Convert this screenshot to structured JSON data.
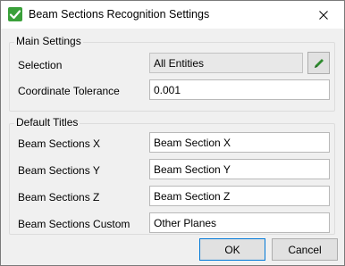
{
  "window": {
    "title": "Beam Sections Recognition Settings"
  },
  "main_settings": {
    "legend": "Main Settings",
    "selection_label": "Selection",
    "selection_value": "All Entities",
    "tolerance_label": "Coordinate Tolerance",
    "tolerance_value": "0.001"
  },
  "default_titles": {
    "legend": "Default Titles",
    "rows": [
      {
        "label": "Beam Sections X",
        "value": "Beam Section X"
      },
      {
        "label": "Beam Sections Y",
        "value": "Beam Section Y"
      },
      {
        "label": "Beam Sections Z",
        "value": "Beam Section Z"
      },
      {
        "label": "Beam Sections Custom",
        "value": "Other Planes"
      }
    ]
  },
  "buttons": {
    "ok": "OK",
    "cancel": "Cancel"
  },
  "colors": {
    "icon_green": "#3aa03a",
    "pencil_green": "#2e8b2e",
    "default_button_border": "#0078d7"
  },
  "icons": {
    "app": "green-checkmark-icon",
    "pick": "pencil-icon",
    "close": "close-icon"
  }
}
